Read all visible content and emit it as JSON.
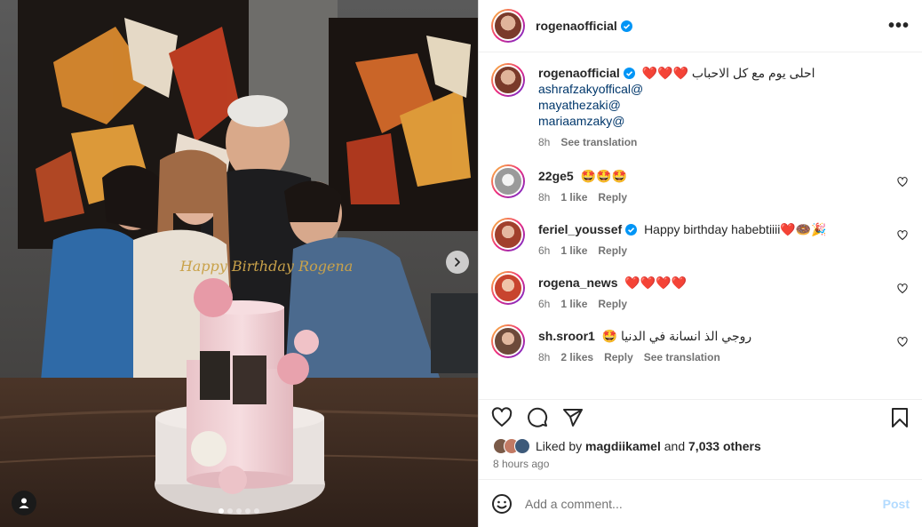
{
  "post": {
    "author": "rogenaofficial",
    "caption": "احلى يوم مع كل الاحباب",
    "caption_emoji": "❤️❤️❤️",
    "mentions": [
      "ashrafzakyoffical@",
      "mayathezaki@",
      "mariaamzaky@"
    ],
    "caption_time": "8h",
    "see_translation": "See translation",
    "cake_topper": "Happy Birthday Rogena"
  },
  "comments": [
    {
      "user": "22ge5",
      "verified": false,
      "text": "🤩🤩🤩",
      "time": "8h",
      "likes": "1 like",
      "reply": "Reply",
      "translate": ""
    },
    {
      "user": "feriel_youssef",
      "verified": true,
      "text": "Happy birthday habebtiiii❤️🍩🎉",
      "time": "6h",
      "likes": "1 like",
      "reply": "Reply",
      "translate": ""
    },
    {
      "user": "rogena_news",
      "verified": false,
      "text": "❤️❤️❤️❤️",
      "time": "6h",
      "likes": "1 like",
      "reply": "Reply",
      "translate": ""
    },
    {
      "user": "sh.sroor1",
      "verified": false,
      "text": "🤩 روجي الذ انسانة في الدنيا",
      "time": "8h",
      "likes": "2 likes",
      "reply": "Reply",
      "translate": "See translation"
    }
  ],
  "likes": {
    "prefix": "Liked by",
    "user": "magdiikamel",
    "and": "and",
    "others": "7,033 others"
  },
  "posted_ago": "8 hours ago",
  "comment_box": {
    "placeholder": "Add a comment...",
    "post_label": "Post"
  },
  "icons": {
    "more": "more-options-icon",
    "verified": "verified-badge-icon",
    "like": "heart-icon",
    "comment": "comment-icon",
    "share": "share-icon",
    "save": "bookmark-icon",
    "emoji": "emoji-icon",
    "next": "chevron-right-icon",
    "tags": "user-tag-icon"
  },
  "colors": {
    "verified": "#0095f6",
    "mention": "#00376b",
    "post_disabled": "#b3dbff",
    "muted": "#737373"
  }
}
